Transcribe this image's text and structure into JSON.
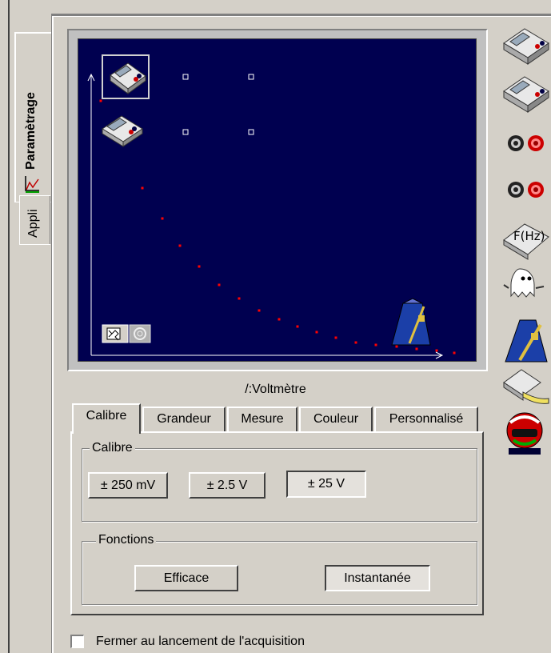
{
  "sidebar": {
    "tabs": [
      {
        "label": "Paramètrage",
        "active": true
      },
      {
        "label": "Appli",
        "active": false
      }
    ]
  },
  "graph": {
    "background": "#000050",
    "point_color": "#ff0000"
  },
  "device": {
    "title": "/:Voltmètre"
  },
  "tabs": [
    "Calibre",
    "Grandeur",
    "Mesure",
    "Couleur",
    "Personnalisé"
  ],
  "active_tab": "Calibre",
  "calibre_group": {
    "legend": "Calibre",
    "buttons": [
      {
        "label": "± 250 mV",
        "pressed": false
      },
      {
        "label": "± 2.5 V",
        "pressed": false
      },
      {
        "label": "± 25 V",
        "pressed": true
      }
    ]
  },
  "fonctions_group": {
    "legend": "Fonctions",
    "buttons": [
      {
        "label": "Efficace",
        "pressed": false
      },
      {
        "label": "Instantanée",
        "pressed": true
      }
    ]
  },
  "options": {
    "close_on_acquisition_label": "Fermer au lancement de l'acquisition",
    "close_on_acquisition_checked": false
  },
  "toolbar": {
    "frequency_label": "F(Hz)"
  }
}
